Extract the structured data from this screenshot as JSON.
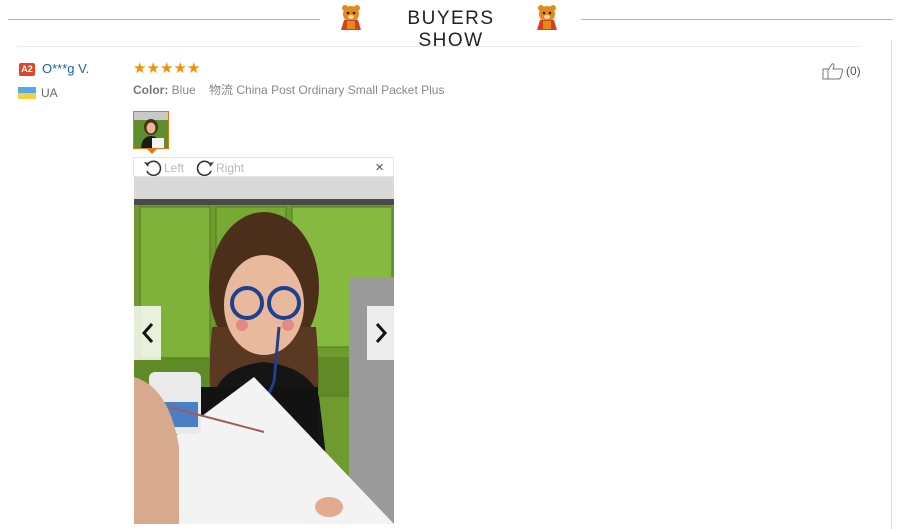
{
  "header": {
    "title": "BUYERS SHOW",
    "mascot_icon": "bear-mascot-icon"
  },
  "review": {
    "level_badge": "A2",
    "username": "O***g V.",
    "country": "UA",
    "rating": 5,
    "stars": [
      "★",
      "★",
      "★",
      "★",
      "★"
    ],
    "color_label": "Color:",
    "color_value": "Blue",
    "shipping": "物流 China Post Ordinary Small Packet Plus",
    "helpful_count": "(0)"
  },
  "viewer": {
    "rotate_left": "Left",
    "rotate_right": "Right",
    "close": "×",
    "prev_icon": "chevron-left-icon",
    "next_icon": "chevron-right-icon"
  },
  "colors": {
    "accent": "#e0780f",
    "star": "#f29100",
    "link": "#1a63b0",
    "badge": "#e0442a"
  }
}
